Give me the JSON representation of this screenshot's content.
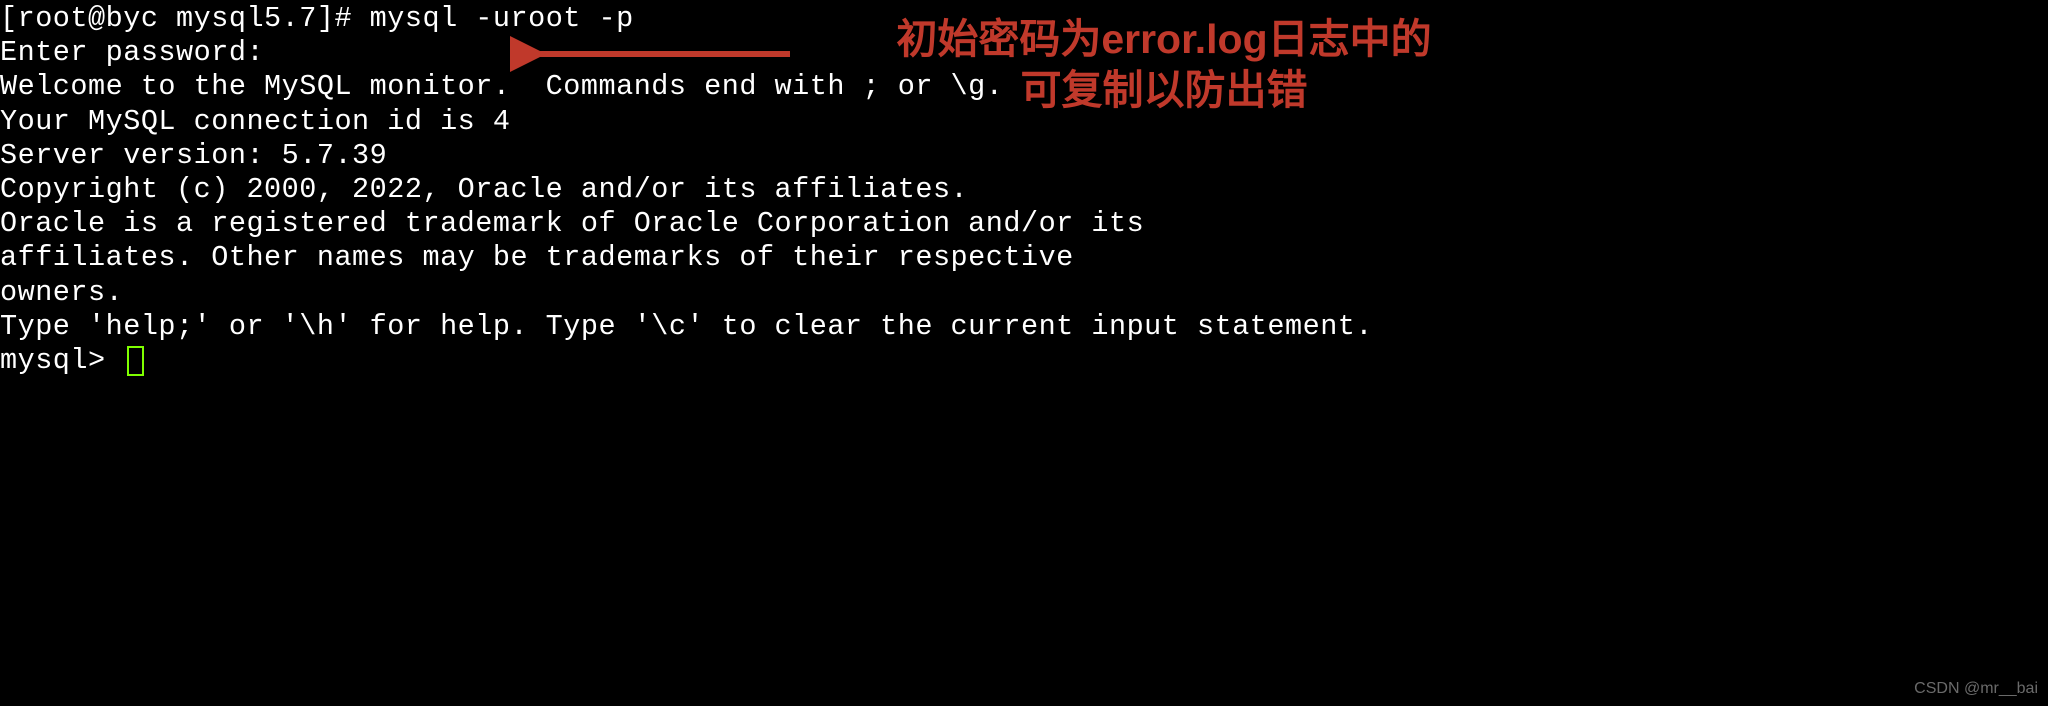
{
  "terminal": {
    "prompt": "[root@byc mysql5.7]# ",
    "command": "mysql -uroot -p",
    "lines": [
      "Enter password:",
      "Welcome to the MySQL monitor.  Commands end with ; or \\g.",
      "Your MySQL connection id is 4",
      "Server version: 5.7.39",
      "",
      "Copyright (c) 2000, 2022, Oracle and/or its affiliates.",
      "",
      "Oracle is a registered trademark of Oracle Corporation and/or its",
      "affiliates. Other names may be trademarks of their respective",
      "owners.",
      "",
      "Type 'help;' or '\\h' for help. Type '\\c' to clear the current input statement.",
      ""
    ],
    "mysql_prompt": "mysql> "
  },
  "annotation": {
    "line1": "初始密码为error.log日志中的",
    "line2": "可复制以防出错",
    "color": "#c0392b"
  },
  "watermark": "CSDN @mr__bai"
}
